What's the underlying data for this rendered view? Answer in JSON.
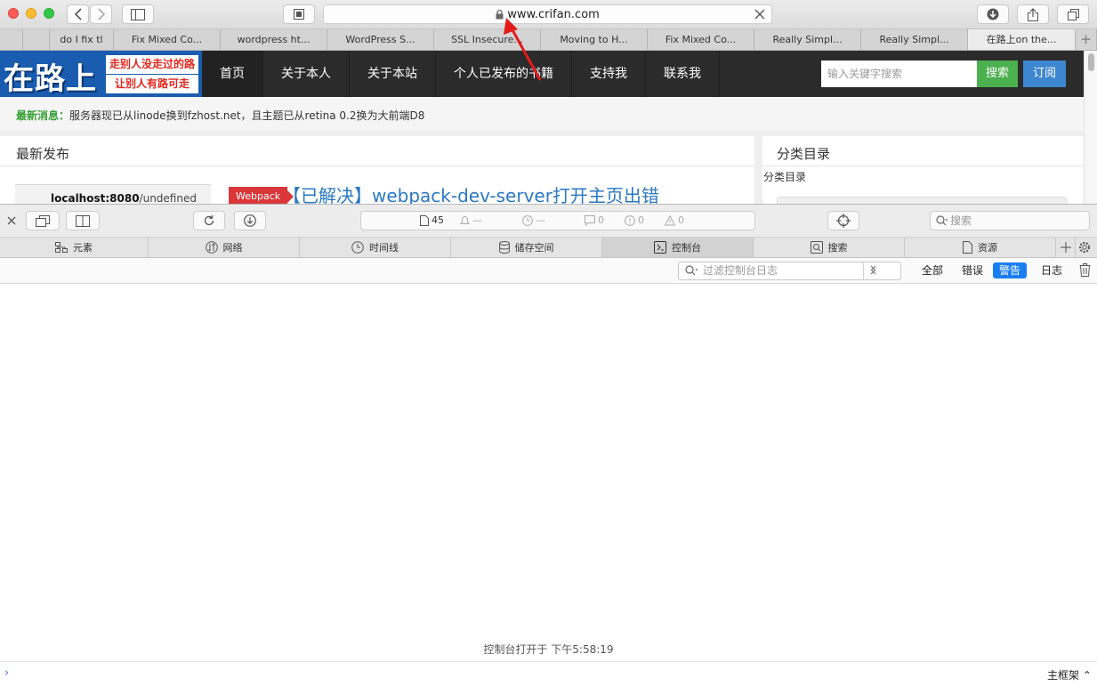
{
  "browser": {
    "url": "www.crifan.com",
    "tabs": [
      {
        "label": ""
      },
      {
        "label": ""
      },
      {
        "label": "do I fix tl"
      },
      {
        "label": "Fix Mixed Co..."
      },
      {
        "label": "wordpress ht..."
      },
      {
        "label": "WordPress S..."
      },
      {
        "label": "SSL Insecure..."
      },
      {
        "label": "Moving to H..."
      },
      {
        "label": "Fix Mixed Co..."
      },
      {
        "label": "Really Simpl..."
      },
      {
        "label": "Really Simpl..."
      },
      {
        "label": "在路上on the..."
      }
    ],
    "new_tab": "+"
  },
  "site": {
    "logo": {
      "main": "在路上",
      "line1": "走别人没走过的路",
      "line2": "让别人有路可走"
    },
    "nav": [
      "首页",
      "关于本人",
      "关于本站",
      "个人已发布的书籍",
      "支持我",
      "联系我"
    ],
    "search_placeholder": "输入关键字搜索",
    "search_button": "搜索",
    "subscribe_button": "订阅",
    "news_label": "最新消息：",
    "news_text": "服务器现已从linode换到fzhost.net，且主题已从retina 0.2换为大前端D8",
    "latest_title": "最新发布",
    "thumb_host": "localhost:8080",
    "thumb_path": "/undefined",
    "category_badge": "Webpack",
    "post_title": "【已解决】webpack-dev-server打开主页出错",
    "sidebar_title": "分类目录",
    "sidebar_sub": "分类目录"
  },
  "inspector": {
    "resource_count": "45",
    "stats": [
      "—",
      "—",
      "0",
      "0",
      "0"
    ],
    "search_placeholder": "搜索",
    "tabs": [
      "元素",
      "网络",
      "时间线",
      "储存空间",
      "控制台",
      "搜索",
      "资源"
    ],
    "active_tab": "控制台",
    "filter_placeholder": "过滤控制台日志",
    "levels": [
      "全部",
      "错误",
      "警告",
      "日志"
    ],
    "selected_level": "警告",
    "console_message": "控制台打开于 下午5:58:19",
    "frame_selector": "主框架 ⌃",
    "prompt": "›"
  }
}
